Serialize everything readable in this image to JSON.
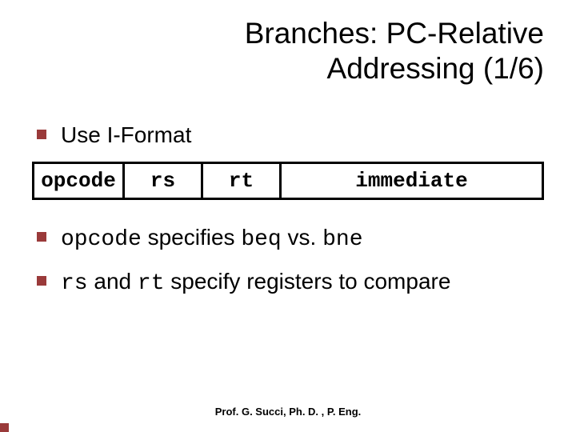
{
  "title_line1": "Branches: PC-Relative",
  "title_line2": "Addressing (1/6)",
  "bullets": {
    "b1": "Use I-Format",
    "b2_opcode": "opcode",
    "b2_mid": " specifies ",
    "b2_beq": "beq",
    "b2_vs": " vs. ",
    "b2_bne": "bne",
    "b3_rs": "rs",
    "b3_and": " and ",
    "b3_rt": "rt",
    "b3_tail": " specify registers to compare"
  },
  "table": {
    "opcode": "opcode",
    "rs": "rs",
    "rt": "rt",
    "immediate": "immediate"
  },
  "footer": "Prof. G. Succi, Ph. D. , P. Eng."
}
